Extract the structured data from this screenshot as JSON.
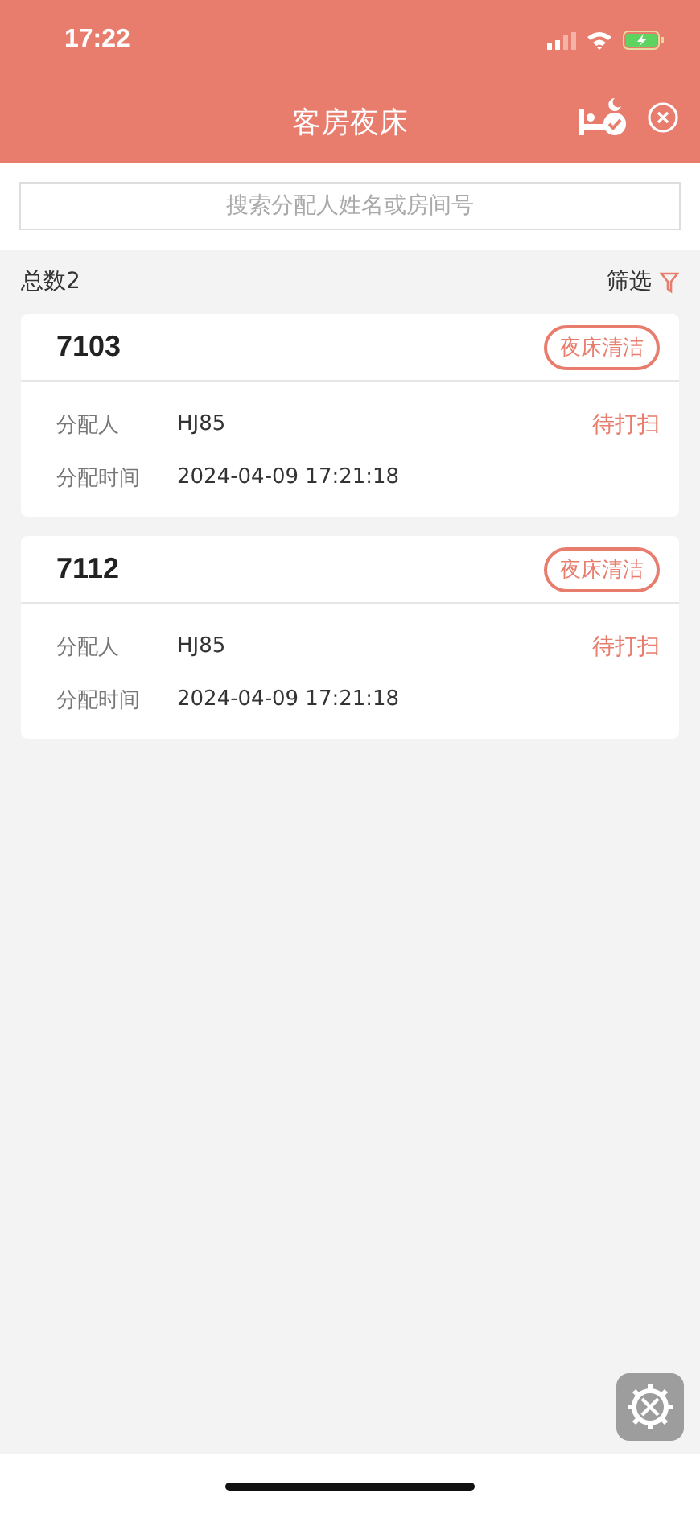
{
  "status_bar": {
    "time": "17:22"
  },
  "header": {
    "title": "客房夜床"
  },
  "search": {
    "placeholder": "搜索分配人姓名或房间号"
  },
  "summary": {
    "total": "总数2",
    "filter": "筛选"
  },
  "cards": [
    {
      "room": "7103",
      "tag": "夜床清洁",
      "assignee_label": "分配人",
      "assignee": "HJ85",
      "status": "待打扫",
      "time_label": "分配时间",
      "time": "2024-04-09 17:21:18"
    },
    {
      "room": "7112",
      "tag": "夜床清洁",
      "assignee_label": "分配人",
      "assignee": "HJ85",
      "status": "待打扫",
      "time_label": "分配时间",
      "time": "2024-04-09 17:21:18"
    }
  ]
}
